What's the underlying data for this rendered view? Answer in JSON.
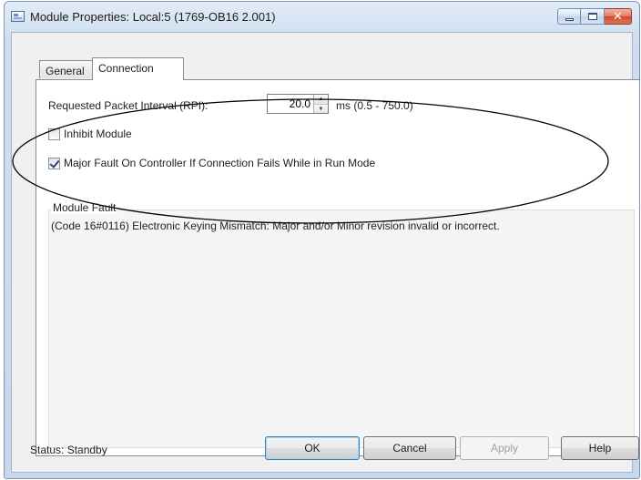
{
  "window": {
    "title": "Module Properties: Local:5 (1769-OB16 2.001)",
    "controls": [
      "minimize-icon",
      "maximize-icon",
      "close-icon"
    ]
  },
  "tabs": [
    {
      "label": "General",
      "selected": false
    },
    {
      "label": "Connection",
      "selected": true
    }
  ],
  "connection": {
    "rpi_label": "Requested Packet Interval (RPI):",
    "rpi_value": "20.0",
    "rpi_range": "ms (0.5 - 750.0)",
    "inhibit_label": "Inhibit Module",
    "inhibit_checked": false,
    "major_fault_label": "Major Fault On Controller If Connection Fails While in Run Mode",
    "major_fault_checked": true
  },
  "module_fault": {
    "title": "Module Fault",
    "message": "(Code 16#0116) Electronic Keying Mismatch: Major and/or Minor revision invalid or incorrect."
  },
  "footer": {
    "status": "Status:  Standby",
    "ok_label": "OK",
    "cancel_label": "Cancel",
    "apply_label": "Apply",
    "help_label": "Help",
    "apply_enabled": false
  },
  "annotation": {
    "shape": "ellipse",
    "color": "#000000"
  }
}
